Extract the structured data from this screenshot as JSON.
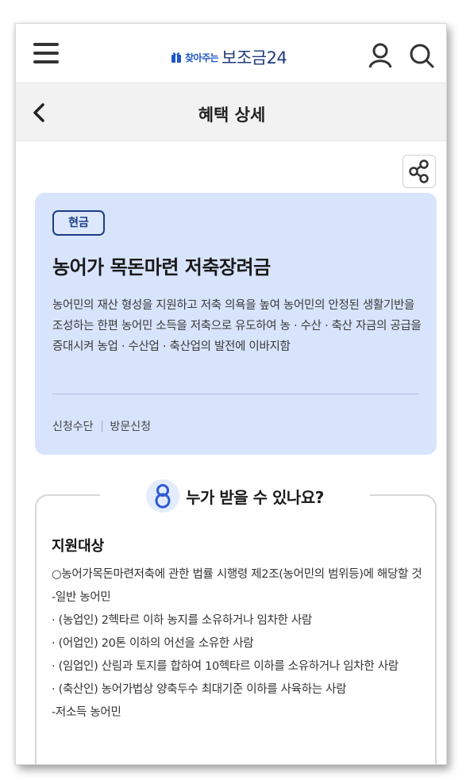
{
  "header": {
    "logo_small": "찾아주는",
    "logo_big": "보조금24"
  },
  "subheader": {
    "title": "혜택 상세"
  },
  "summary": {
    "badge": "현금",
    "title": "농어가 목돈마련 저축장려금",
    "description": "농어민의 재산 형성을 지원하고 저축 의욕을 높여 농어민의 안정된 생활기반을 조성하는 한편 농어민 소득을 저축으로 유도하여 농 · 수산 · 축산 자금의 공급을 증대시켜 농업 · 수산업 · 축산업의 발전에 이바지함",
    "meta_label": "신청수단",
    "meta_value": "방문신청"
  },
  "who": {
    "title": "누가 받을 수 있나요?",
    "target_title": "지원대상",
    "lines": [
      "○농어가목돈마련저축에 관한 법률 시행령 제2조(농어민의 범위등)에 해당할 것",
      "-일반 농어민",
      "· (농업인) 2헥타르 이하 농지를 소유하거나 임차한 사람",
      "· (어업인) 20톤 이하의 어선을 소유한 사람",
      "· (임업인) 산림과 토지를 합하여 10헥타르 이하를 소유하거나 임차한 사람",
      "· (축산인) 농어가법상 양축두수 최대기준 이하를 사육하는 사람",
      "-저소득 농어민"
    ]
  },
  "colors": {
    "accent": "#1a3d86",
    "summary_bg": "#d8e4fc",
    "subheader_bg": "#f2f2f2"
  },
  "icons": [
    "menu-icon",
    "gift-icon",
    "user-icon",
    "search-icon",
    "back-arrow-icon",
    "share-icon",
    "person-icon"
  ]
}
